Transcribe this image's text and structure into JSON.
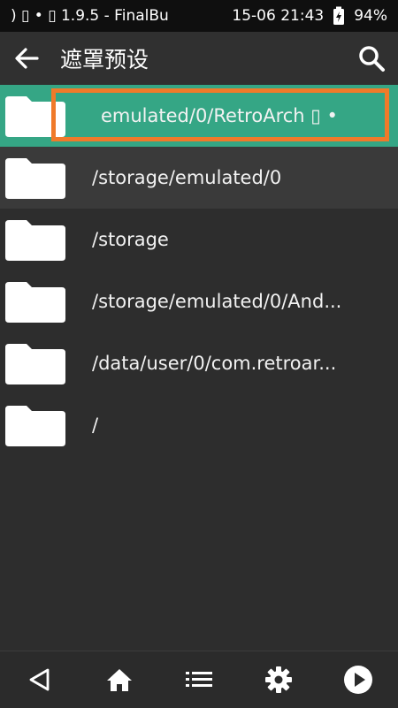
{
  "status_bar": {
    "left_text": ") ▯ • ▯ 1.9.5 - FinalBu",
    "datetime": "15-06 21:43",
    "battery": "94%"
  },
  "app_bar": {
    "title": "遮罩预设",
    "back_icon": "arrow-left-icon",
    "search_icon": "search-icon"
  },
  "list": {
    "items": [
      {
        "label": "emulated/0/RetroArch ▯ •",
        "icon": "folder-icon",
        "selected": true
      },
      {
        "label": "/storage/emulated/0",
        "icon": "folder-icon"
      },
      {
        "label": "/storage",
        "icon": "folder-icon"
      },
      {
        "label": "/storage/emulated/0/And...",
        "icon": "folder-icon"
      },
      {
        "label": "/data/user/0/com.retroar...",
        "icon": "folder-icon"
      },
      {
        "label": "/",
        "icon": "folder-icon"
      }
    ]
  },
  "bottom_nav": {
    "icons": [
      "back-triangle-icon",
      "home-icon",
      "list-icon",
      "gear-icon",
      "play-icon"
    ]
  },
  "colors": {
    "accent": "#35a685",
    "focus_outline": "#f07a2a",
    "background": "#2d2d2d"
  }
}
